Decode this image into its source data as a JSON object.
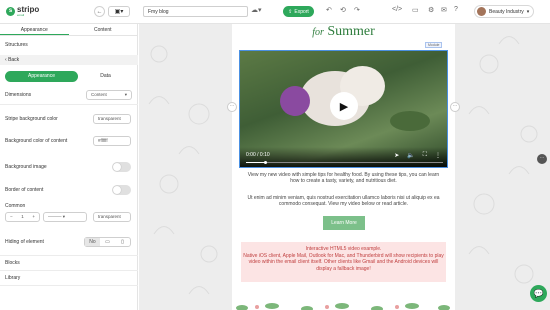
{
  "header": {
    "logo_brand": "stripo",
    "logo_sub": "email",
    "email_name": "Fmy blog",
    "export_label": "Export",
    "user_name": "Beauty Industry"
  },
  "sidebar": {
    "tabs": [
      "Appearance",
      "Content"
    ],
    "section_title": "Structures",
    "back_label": "Back",
    "segments": [
      "Appearance",
      "Data"
    ],
    "properties": {
      "dimensions_label": "Dimensions",
      "dimensions_value": "Content",
      "block_bg_label": "Stripe background color",
      "block_bg_value": "transparent",
      "content_bg_label": "Background color of content",
      "content_bg_value": "#ffffff",
      "bg_image_label": "Background image",
      "border_label": "Border of content",
      "border_sub_label": "Common",
      "border_width": "1",
      "border_color": "transparent",
      "hide_label": "Hiding of element",
      "hide_options": [
        "No",
        "▭",
        "▯"
      ]
    },
    "bottom_sections": [
      "Blocks",
      "Library"
    ]
  },
  "email": {
    "headline_pre": "for",
    "headline_main": "Summer",
    "module_badge": "Module",
    "video": {
      "time": "0:00 / 0:10",
      "progress": 0.1
    },
    "paragraph1": "View my new video with simple tips for healthy food. By using these tips, you can learn how to create a tasty, variety, and nutritious diet.",
    "paragraph2": "Ut enim ad minim veniam, quis nostrud exercitation ullamco laboris nisi ut aliquip ex ea commodo consequat. View my video below or read article.",
    "button_label": "Learn More",
    "notice_title": "Interactive HTML5 video example.",
    "notice_body": "Native iOS client, Apple Mail, Outlook for Mac, and Thunderbird will show recipients to play video within the email client itself. Other clients like Gmail and the Android devices will display a fallback image!"
  },
  "colors": {
    "accent": "#2ea85b",
    "headline": "#2e7d3d",
    "notice_bg": "#fce4e4",
    "notice_text": "#c04040"
  }
}
